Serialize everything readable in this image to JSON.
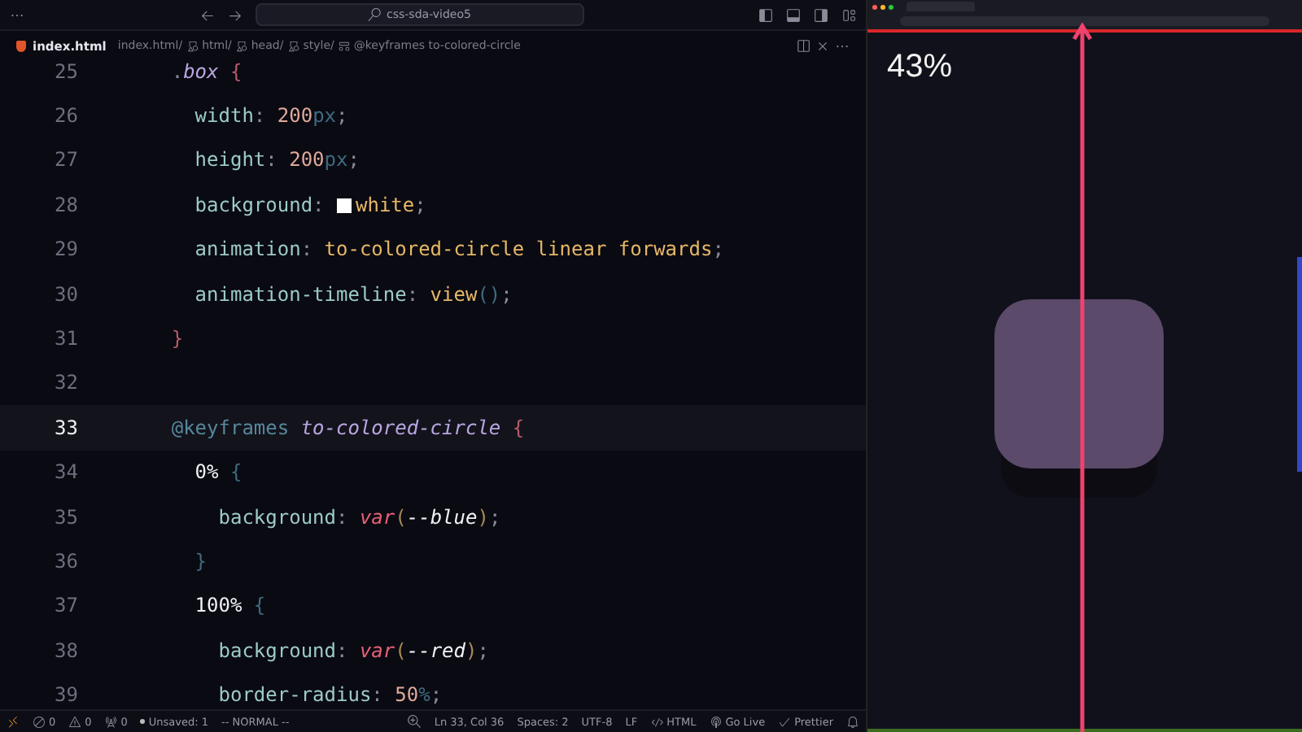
{
  "title_bar": {
    "search": "css-sda-video5"
  },
  "editor_tab": {
    "label": "index.html",
    "selected": true
  },
  "breadcrumbs": [
    {
      "label": "index.html",
      "kind": "file",
      "separator": "/"
    },
    {
      "label": "html",
      "kind": "symbol",
      "separator": "/"
    },
    {
      "label": "head",
      "kind": "symbol",
      "separator": "/"
    },
    {
      "label": "style",
      "kind": "symbol",
      "separator": "/"
    },
    {
      "label": "@keyframes to-colored-circle",
      "kind": "keyframes"
    }
  ],
  "code_lines": [
    {
      "number": "25",
      "current": false,
      "tokens": [
        {
          "text": "      .",
          "kind": "punct"
        },
        {
          "text": "box",
          "kind": "name"
        },
        {
          "text": " {",
          "kind": "brace"
        }
      ]
    },
    {
      "number": "26",
      "current": false,
      "tokens": [
        {
          "text": "        width",
          "kind": "prop"
        },
        {
          "text": ": ",
          "kind": "punct"
        },
        {
          "text": "200",
          "kind": "num"
        },
        {
          "text": "px",
          "kind": "unit"
        },
        {
          "text": ";",
          "kind": "punct"
        }
      ]
    },
    {
      "number": "27",
      "current": false,
      "tokens": [
        {
          "text": "        height",
          "kind": "prop"
        },
        {
          "text": ": ",
          "kind": "punct"
        },
        {
          "text": "200",
          "kind": "num"
        },
        {
          "text": "px",
          "kind": "unit"
        },
        {
          "text": ";",
          "kind": "punct"
        }
      ]
    },
    {
      "number": "28",
      "current": false,
      "tokens": [
        {
          "text": "        background",
          "kind": "prop"
        },
        {
          "text": ": ",
          "kind": "punct"
        },
        {
          "kind": "swatch",
          "color": "#ffffff"
        },
        {
          "text": "white",
          "kind": "value"
        },
        {
          "text": ";",
          "kind": "punct"
        }
      ]
    },
    {
      "number": "29",
      "current": false,
      "tokens": [
        {
          "text": "        animation",
          "kind": "prop"
        },
        {
          "text": ": ",
          "kind": "punct"
        },
        {
          "text": "to-colored-circle linear forwards",
          "kind": "value"
        },
        {
          "text": ";",
          "kind": "punct"
        }
      ]
    },
    {
      "number": "30",
      "current": false,
      "tokens": [
        {
          "text": "        animation-timeline",
          "kind": "prop"
        },
        {
          "text": ": ",
          "kind": "punct"
        },
        {
          "text": "view",
          "kind": "value"
        },
        {
          "text": "()",
          "kind": "unit"
        },
        {
          "text": ";",
          "kind": "punct"
        }
      ]
    },
    {
      "number": "31",
      "current": false,
      "tokens": [
        {
          "text": "      }",
          "kind": "brace"
        }
      ]
    },
    {
      "number": "32",
      "current": false
    },
    {
      "number": "33",
      "current": true,
      "tokens": [
        {
          "text": "      @keyframes",
          "kind": "at"
        },
        {
          "text": " to-colored-circle",
          "kind": "name"
        },
        {
          "text": " {",
          "kind": "brace"
        }
      ]
    },
    {
      "number": "34",
      "current": false,
      "tokens": [
        {
          "text": "        0%",
          "kind": "plain"
        },
        {
          "text": " {",
          "kind": "unit"
        }
      ]
    },
    {
      "number": "35",
      "current": false,
      "tokens": [
        {
          "text": "          background",
          "kind": "prop"
        },
        {
          "text": ": ",
          "kind": "punct"
        },
        {
          "text": "var",
          "kind": "fn"
        },
        {
          "text": "(",
          "kind": "paren"
        },
        {
          "text": "--blue",
          "kind": "ident"
        },
        {
          "text": ")",
          "kind": "paren"
        },
        {
          "text": ";",
          "kind": "punct"
        }
      ]
    },
    {
      "number": "36",
      "current": false,
      "tokens": [
        {
          "text": "        }",
          "kind": "unit"
        }
      ]
    },
    {
      "number": "37",
      "current": false,
      "tokens": [
        {
          "text": "        100%",
          "kind": "plain"
        },
        {
          "text": " {",
          "kind": "unit"
        }
      ]
    },
    {
      "number": "38",
      "current": false,
      "tokens": [
        {
          "text": "          background",
          "kind": "prop"
        },
        {
          "text": ": ",
          "kind": "punct"
        },
        {
          "text": "var",
          "kind": "fn"
        },
        {
          "text": "(",
          "kind": "paren"
        },
        {
          "text": "--red",
          "kind": "ident"
        },
        {
          "text": ")",
          "kind": "paren"
        },
        {
          "text": ";",
          "kind": "punct"
        }
      ]
    },
    {
      "number": "39",
      "current": false,
      "tokens": [
        {
          "text": "          border-radius",
          "kind": "prop"
        },
        {
          "text": ": ",
          "kind": "punct"
        },
        {
          "text": "50",
          "kind": "num"
        },
        {
          "text": "%",
          "kind": "unit"
        },
        {
          "text": ";",
          "kind": "punct"
        }
      ]
    }
  ],
  "status_left": [
    {
      "kind": "errors",
      "label": "0"
    },
    {
      "kind": "warnings",
      "label": "0"
    },
    {
      "kind": "ports",
      "label": "0"
    },
    {
      "kind": "unsaved",
      "label": "Unsaved: 1"
    },
    {
      "kind": "text",
      "label": "-- NORMAL --"
    }
  ],
  "status_right": [
    {
      "kind": "zoom"
    },
    {
      "kind": "text",
      "label": "Ln 33, Col 36"
    },
    {
      "kind": "text",
      "label": "Spaces: 2"
    },
    {
      "kind": "text",
      "label": "UTF-8"
    },
    {
      "kind": "text",
      "label": "LF"
    },
    {
      "kind": "language",
      "label": "HTML"
    },
    {
      "kind": "golive",
      "label": "Go Live"
    },
    {
      "kind": "prettier",
      "label": "Prettier"
    }
  ],
  "preview": {
    "progress": "43%"
  }
}
